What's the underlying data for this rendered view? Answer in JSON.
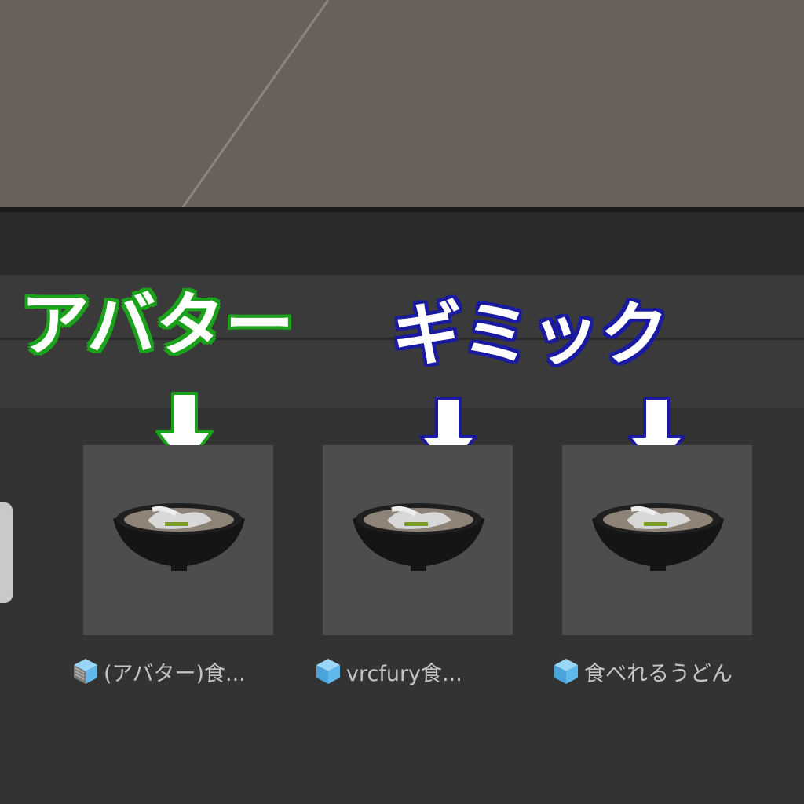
{
  "annotations": {
    "avatar": {
      "text": "アバター",
      "outline_color": "#1aa31a"
    },
    "gimmick": {
      "text": "ギミック",
      "outline_color": "#1a1aa0"
    }
  },
  "assets": [
    {
      "label": "(アバター)食...",
      "icon": "prefab-variant-icon",
      "thumbnail": "udon-bowl-icon",
      "arrow_color": "#1aa31a"
    },
    {
      "label": "vrcfury食...",
      "icon": "prefab-icon",
      "thumbnail": "udon-bowl-icon",
      "arrow_color": "#1a1aa0"
    },
    {
      "label": "食べれるうどん",
      "icon": "prefab-icon",
      "thumbnail": "udon-bowl-icon",
      "arrow_color": "#1a1aa0"
    }
  ],
  "colors": {
    "scene_background": "#67605b",
    "panel_background": "#333333",
    "tile_background": "#4d4d4d",
    "prefab_blue": "#5fb9ec"
  }
}
